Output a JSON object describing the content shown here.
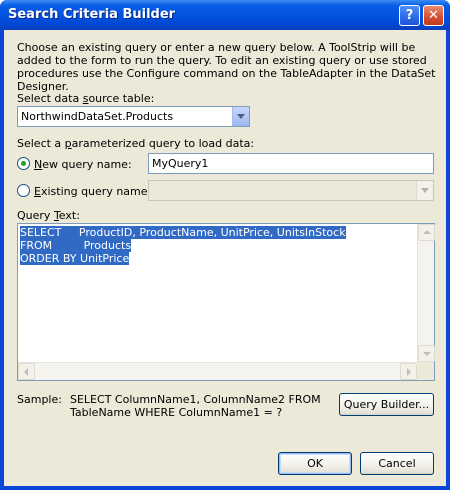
{
  "window": {
    "title": "Search Criteria Builder",
    "help_label": "?",
    "close_label": "✕"
  },
  "intro_text": "Choose an existing query or enter a new query below. A ToolStrip will be added to the form to run the query. To edit an existing query or use stored procedures use the Configure command on the TableAdapter in the DataSet Designer.",
  "data_source": {
    "label_pre": "Select data ",
    "label_accel": "s",
    "label_post": "ource table:",
    "selected": "NorthwindDataSet.Products"
  },
  "param_query_label": {
    "pre": "Select a ",
    "accel": "p",
    "post": "arameterized query to load data:"
  },
  "new_query": {
    "label_accel": "N",
    "label_post": "ew query name:",
    "value": "MyQuery1",
    "checked": true
  },
  "existing_query": {
    "label_accel": "E",
    "label_post": "xisting query name:",
    "value": "",
    "checked": false
  },
  "query_text": {
    "label_pre": "Query ",
    "label_accel": "T",
    "label_post": "ext:",
    "lines": [
      "SELECT     ProductID, ProductName, UnitPrice, UnitsInStock",
      "FROM         Products",
      "ORDER BY UnitPrice"
    ]
  },
  "sample": {
    "label": "Sample:",
    "line1": "SELECT ColumnName1, ColumnName2 FROM",
    "line2": "TableName WHERE ColumnName1 = ?"
  },
  "buttons": {
    "query_builder": "Query Builder...",
    "ok": "OK",
    "cancel": "Cancel"
  },
  "colors": {
    "titlebar": "#0353e0",
    "client": "#ece9d8",
    "selection": "#316ac5"
  }
}
